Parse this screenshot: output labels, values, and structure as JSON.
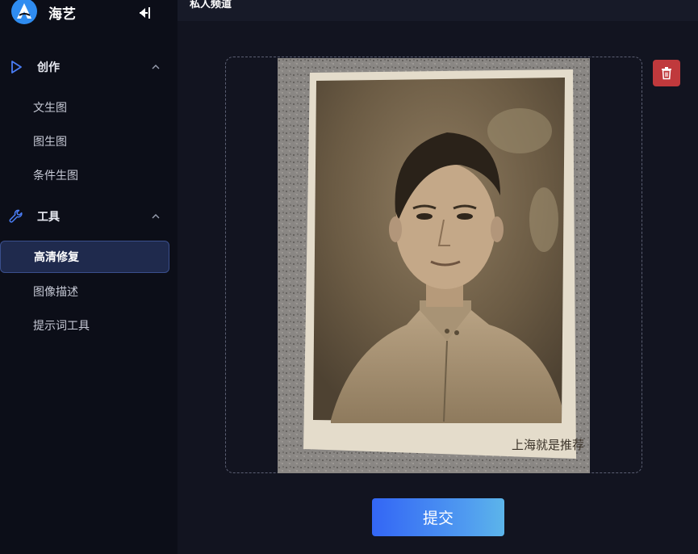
{
  "brand": {
    "name": "海艺",
    "logo_icon": "brand-logo-icon"
  },
  "sidebar": {
    "collapse_icon": "collapse-left-icon",
    "groups": [
      {
        "label": "创作",
        "icon": "play-outline-icon",
        "items": [
          {
            "label": "文生图"
          },
          {
            "label": "图生图"
          },
          {
            "label": "条件生图"
          }
        ]
      },
      {
        "label": "工具",
        "icon": "wrench-icon",
        "items": [
          {
            "label": "高清修复",
            "active": true
          },
          {
            "label": "图像描述"
          },
          {
            "label": "提示词工具"
          }
        ]
      }
    ]
  },
  "header": {
    "title": "私人频道"
  },
  "photo": {
    "caption": "上海就是推荐"
  },
  "actions": {
    "submit_label": "提交",
    "delete_icon": "trash-icon"
  },
  "colors": {
    "sidebar_bg": "#0c0e18",
    "main_bg": "#121420",
    "active_item_bg": "#1f2a4d",
    "delete_red": "#c0393c",
    "submit_gradient_start": "#3366f5",
    "submit_gradient_end": "#5cb5ea"
  }
}
